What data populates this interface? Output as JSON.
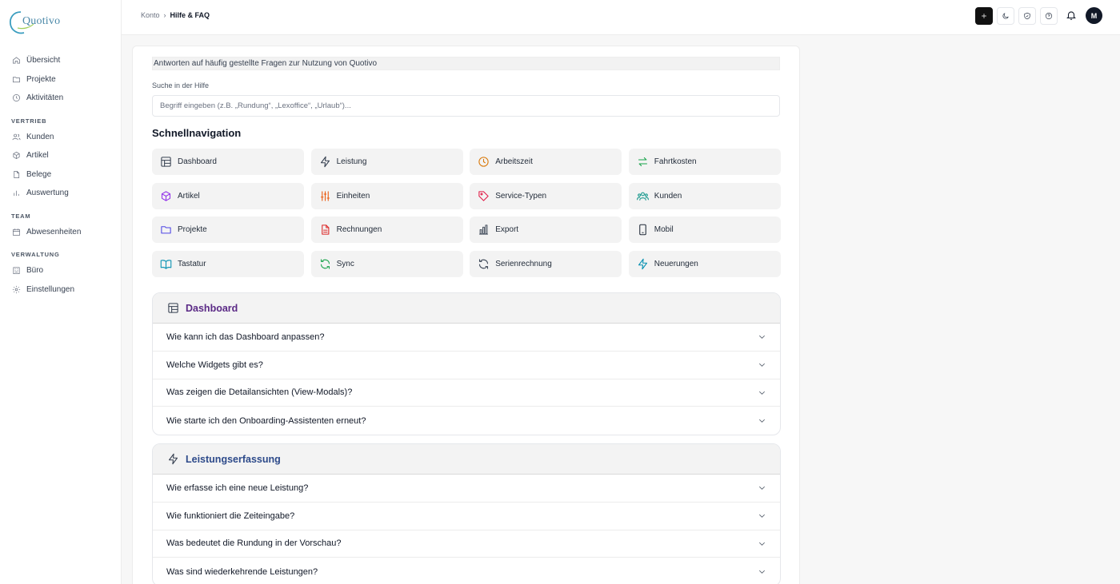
{
  "brand": {
    "logo_text": "Quotivo"
  },
  "sidebar": {
    "top": [
      {
        "label": "Übersicht",
        "icon": "home-icon"
      },
      {
        "label": "Projekte",
        "icon": "folder-icon"
      },
      {
        "label": "Aktivitäten",
        "icon": "clock-icon"
      }
    ],
    "sections": [
      {
        "title": "VERTRIEB",
        "items": [
          {
            "label": "Kunden",
            "icon": "users-icon"
          },
          {
            "label": "Artikel",
            "icon": "box-icon"
          },
          {
            "label": "Belege",
            "icon": "file-icon"
          },
          {
            "label": "Auswertung",
            "icon": "bar-chart-icon"
          }
        ]
      },
      {
        "title": "TEAM",
        "items": [
          {
            "label": "Abwesenheiten",
            "icon": "calendar-icon"
          }
        ]
      },
      {
        "title": "VERWALTUNG",
        "items": [
          {
            "label": "Büro",
            "icon": "building-icon"
          },
          {
            "label": "Einstellungen",
            "icon": "gear-icon"
          }
        ]
      }
    ]
  },
  "header": {
    "breadcrumb": {
      "parent": "Konto",
      "separator": "›",
      "current": "Hilfe & FAQ"
    },
    "avatar_initial": "M"
  },
  "main": {
    "intro": "Antworten auf häufig gestellte Fragen zur Nutzung von Quotivo",
    "search": {
      "label": "Suche in der Hilfe",
      "placeholder": "Begriff eingeben (z.B. „Rundung“, „Lexoffice“, „Urlaub“)..."
    },
    "quick_nav_title": "Schnellnavigation",
    "quick_nav": [
      {
        "label": "Dashboard",
        "icon": "layout-icon",
        "color": "#374151"
      },
      {
        "label": "Leistung",
        "icon": "lightning-icon",
        "color": "#374151"
      },
      {
        "label": "Arbeitszeit",
        "icon": "clock-icon",
        "color": "#d97706"
      },
      {
        "label": "Fahrtkosten",
        "icon": "arrows-icon",
        "color": "#16a34a"
      },
      {
        "label": "Artikel",
        "icon": "box-icon",
        "color": "#9333ea"
      },
      {
        "label": "Einheiten",
        "icon": "sliders-icon",
        "color": "#ea580c"
      },
      {
        "label": "Service-Typen",
        "icon": "tag-icon",
        "color": "#e11d48"
      },
      {
        "label": "Kunden",
        "icon": "users-icon",
        "color": "#0d9488"
      },
      {
        "label": "Projekte",
        "icon": "folder-icon",
        "color": "#4f46e5"
      },
      {
        "label": "Rechnungen",
        "icon": "invoice-icon",
        "color": "#dc2626"
      },
      {
        "label": "Export",
        "icon": "chart-icon",
        "color": "#4b5563"
      },
      {
        "label": "Mobil",
        "icon": "phone-icon",
        "color": "#1f2937"
      },
      {
        "label": "Tastatur",
        "icon": "book-icon",
        "color": "#0891b2"
      },
      {
        "label": "Sync",
        "icon": "refresh-icon",
        "color": "#16a34a"
      },
      {
        "label": "Serienrechnung",
        "icon": "refresh-icon",
        "color": "#374151"
      },
      {
        "label": "Neuerungen",
        "icon": "lightning-icon",
        "color": "#0891b2"
      }
    ],
    "faq_sections": [
      {
        "title": "Dashboard",
        "icon": "layout-icon",
        "title_color": "#5b2a86",
        "questions": [
          "Wie kann ich das Dashboard anpassen?",
          "Welche Widgets gibt es?",
          "Was zeigen die Detailansichten (View-Modals)?",
          "Wie starte ich den Onboarding-Assistenten erneut?"
        ]
      },
      {
        "title": "Leistungserfassung",
        "icon": "lightning-icon",
        "title_color": "#2d4a8a",
        "questions": [
          "Wie erfasse ich eine neue Leistung?",
          "Wie funktioniert die Zeiteingabe?",
          "Was bedeutet die Rundung in der Vorschau?",
          "Was sind wiederkehrende Leistungen?"
        ]
      }
    ]
  }
}
